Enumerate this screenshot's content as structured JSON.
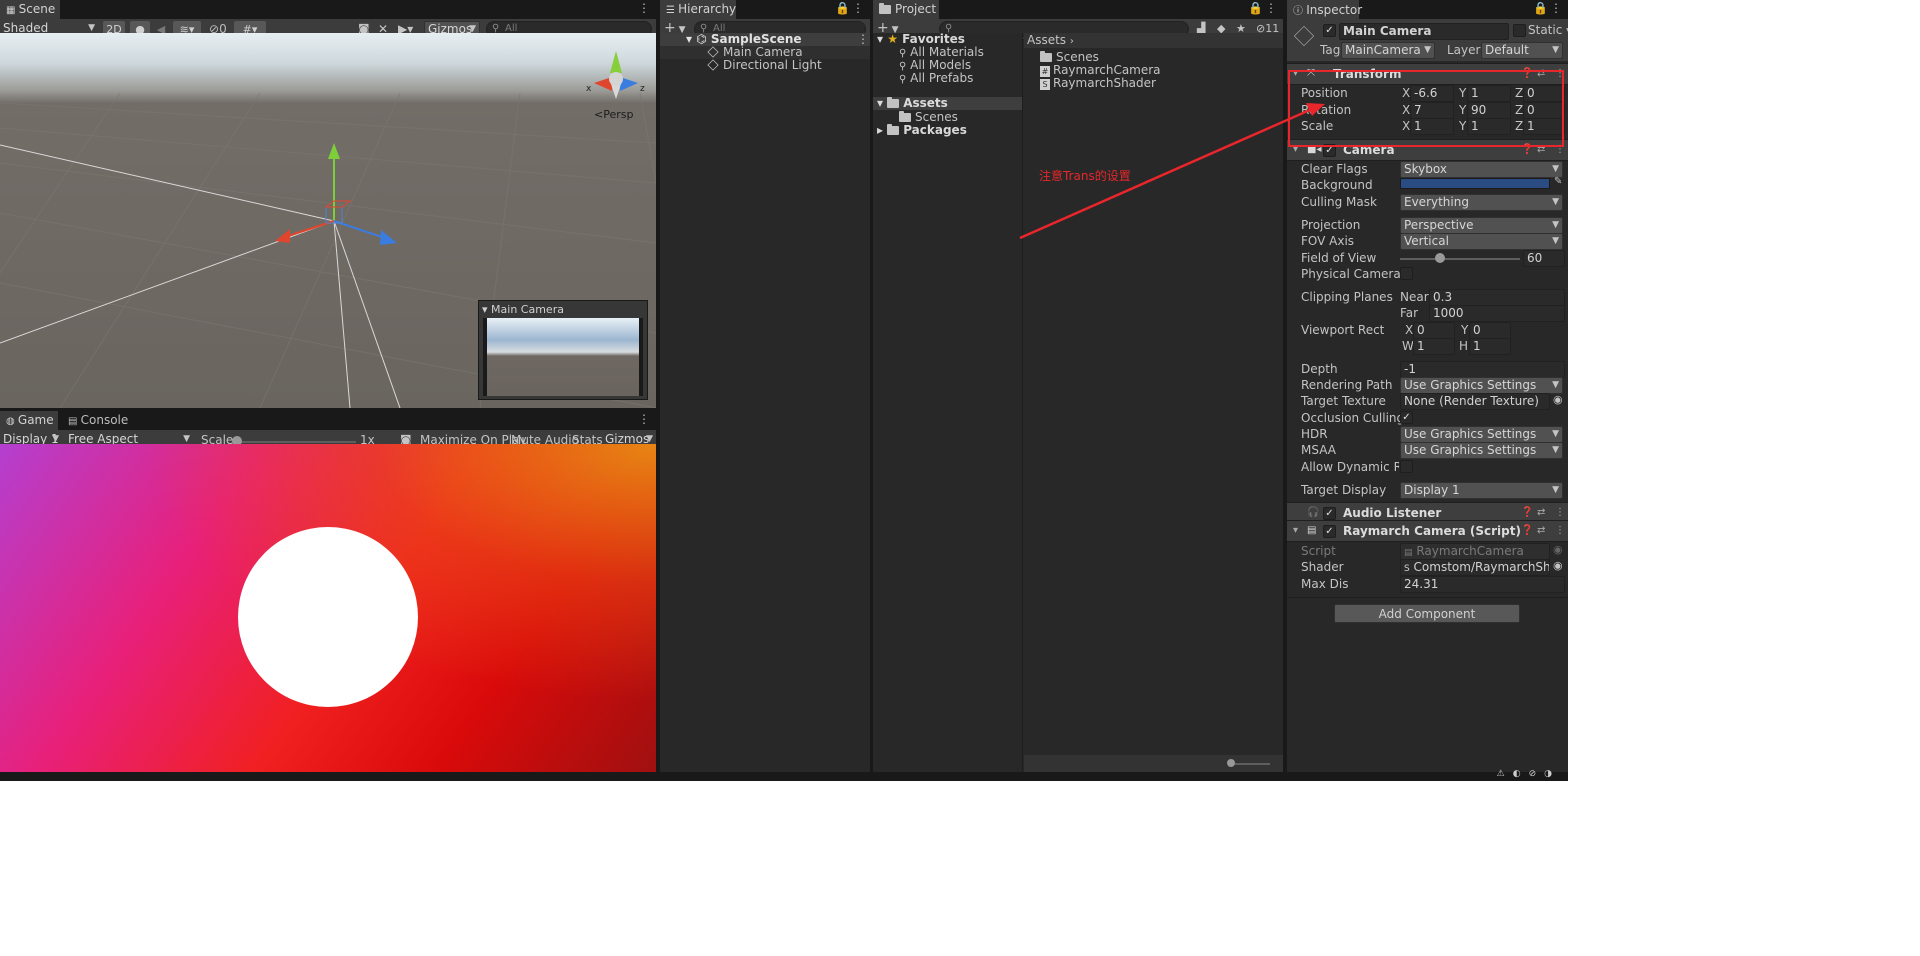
{
  "scene": {
    "tab": "Scene",
    "shading": "Shaded",
    "btn_2d": "2D",
    "hidden_count": "0",
    "gizmos": "Gizmos",
    "search_placeholder": "All",
    "persp": "Persp",
    "camera_preview_title": "Main Camera"
  },
  "game": {
    "tabs": [
      "Game",
      "Console"
    ],
    "display": "Display 1",
    "aspect": "Free Aspect",
    "scale_label": "Scale",
    "scale_value": "1x",
    "maximize": "Maximize On Play",
    "mute": "Mute Audio",
    "stats": "Stats",
    "gizmos": "Gizmos"
  },
  "hierarchy": {
    "tab": "Hierarchy",
    "search_placeholder": "All",
    "scene_name": "SampleScene",
    "items": [
      "Main Camera",
      "Directional Light"
    ]
  },
  "project": {
    "tab": "Project",
    "hidden_count": "11",
    "favorites_label": "Favorites",
    "favorites": [
      "All Materials",
      "All Models",
      "All Prefabs"
    ],
    "tree": {
      "assets": "Assets",
      "scenes": "Scenes",
      "packages": "Packages"
    },
    "breadcrumb": "Assets",
    "files": [
      "Scenes",
      "RaymarchCamera",
      "RaymarchShader"
    ]
  },
  "annotation": {
    "text": "注意Trans的设置",
    "color": "#e8262b"
  },
  "inspector": {
    "tab": "Inspector",
    "object_name": "Main Camera",
    "static_label": "Static",
    "tag_label": "Tag",
    "tag_value": "MainCamera",
    "layer_label": "Layer",
    "layer_value": "Default",
    "transform": {
      "title": "Transform",
      "position_label": "Position",
      "rotation_label": "Rotation",
      "scale_label": "Scale",
      "axes": [
        "X",
        "Y",
        "Z"
      ],
      "position": [
        "-6.6",
        "1",
        "0"
      ],
      "rotation": [
        "7",
        "90",
        "0"
      ],
      "scale": [
        "1",
        "1",
        "1"
      ]
    },
    "camera": {
      "title": "Camera",
      "clear_flags_label": "Clear Flags",
      "clear_flags": "Skybox",
      "background_label": "Background",
      "background_color": "#2a4c82",
      "culling_mask_label": "Culling Mask",
      "culling_mask": "Everything",
      "projection_label": "Projection",
      "projection": "Perspective",
      "fov_axis_label": "FOV Axis",
      "fov_axis": "Vertical",
      "fov_label": "Field of View",
      "fov": "60",
      "fov_fraction": 0.33,
      "physical_label": "Physical Camera",
      "clipping_label": "Clipping Planes",
      "near_label": "Near",
      "near": "0.3",
      "far_label": "Far",
      "far": "1000",
      "viewport_label": "Viewport Rect",
      "vx_label": "X",
      "vx": "0",
      "vy_label": "Y",
      "vy": "0",
      "vw_label": "W",
      "vw": "1",
      "vh_label": "H",
      "vh": "1",
      "depth_label": "Depth",
      "depth": "-1",
      "rendering_path_label": "Rendering Path",
      "rendering_path": "Use Graphics Settings",
      "target_texture_label": "Target Texture",
      "target_texture": "None (Render Texture)",
      "occlusion_label": "Occlusion Culling",
      "hdr_label": "HDR",
      "hdr": "Use Graphics Settings",
      "msaa_label": "MSAA",
      "msaa": "Use Graphics Settings",
      "dynres_label": "Allow Dynamic Resol",
      "target_display_label": "Target Display",
      "target_display": "Display 1"
    },
    "audio_listener": {
      "title": "Audio Listener"
    },
    "raymarch": {
      "title": "Raymarch Camera (Script)",
      "script_label": "Script",
      "script": "RaymarchCamera",
      "shader_label": "Shader",
      "shader": "Comstom/RaymarchShader",
      "maxdis_label": "Max Dis",
      "maxdis": "24.31"
    },
    "add_component": "Add Component"
  }
}
